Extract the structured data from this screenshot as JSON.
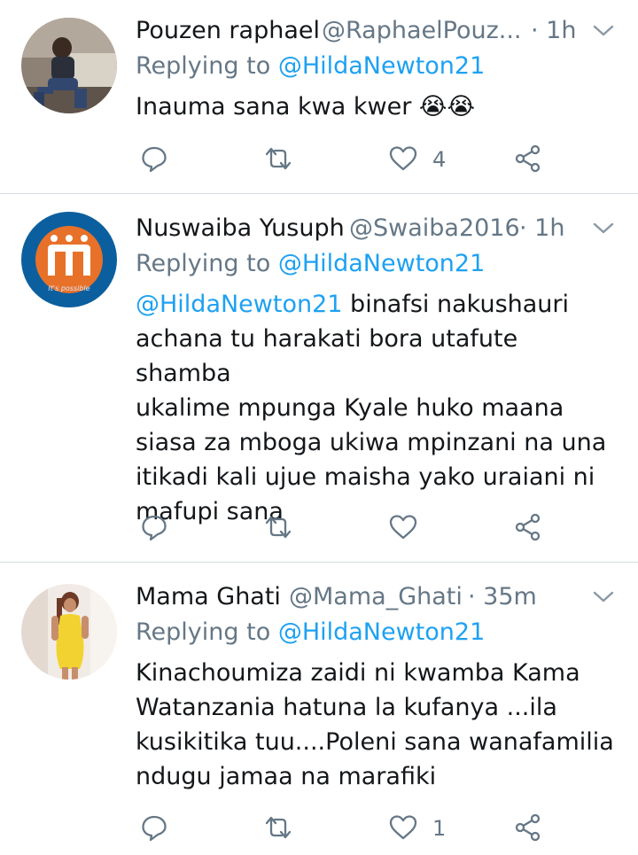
{
  "tweets": [
    {
      "name": "Pouzen raphael",
      "handle": "@RaphaelPouz...",
      "time": "· 1h",
      "replying_prefix": "Replying to ",
      "replying_to": "@HildaNewton21",
      "text": "Inauma sana kwa kwer",
      "emoji": "😭😭",
      "reply_count": "",
      "retweet_count": "",
      "like_count": "4"
    },
    {
      "name": "Nuswaiba Yusuph",
      "handle": "@Swaiba2016",
      "time": "· 1h",
      "replying_prefix": "Replying to ",
      "replying_to": "@HildaNewton21",
      "mention": "@HildaNewton21",
      "text_line1_rest": " binafsi nakushauri",
      "lines": [
        "achana tu harakati bora utafute shamba",
        "ukalime mpunga Kyale huko maana",
        "siasa za mboga ukiwa mpinzani na una",
        "itikadi kali ujue maisha yako uraiani ni",
        "mafupi sana"
      ],
      "avatar_caption": "It's possible",
      "reply_count": "",
      "retweet_count": "",
      "like_count": ""
    },
    {
      "name": "Mama Ghati",
      "handle": "@Mama_Ghati",
      "time": "· 35m",
      "replying_prefix": "Replying to ",
      "replying_to": "@HildaNewton21",
      "lines": [
        "Kinachoumiza zaidi ni kwamba Kama",
        "Watanzania hatuna la kufanya ...ila",
        "kusikitika tuu....Poleni sana wanafamilia",
        "ndugu jamaa na marafiki"
      ],
      "reply_count": "",
      "retweet_count": "",
      "like_count": "1"
    }
  ],
  "icons": [
    "reply-icon",
    "retweet-icon",
    "like-icon",
    "share-icon",
    "chevron-down-icon"
  ],
  "colors": {
    "text": "#14171a",
    "secondary": "#657786",
    "link": "#1da1f2",
    "divider": "#d4dbe0"
  }
}
